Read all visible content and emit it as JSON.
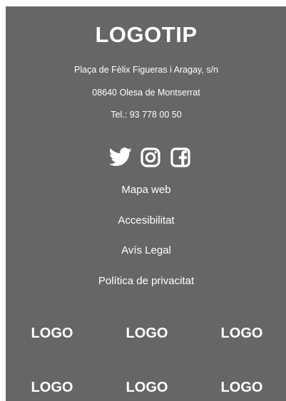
{
  "footer": {
    "title": "LOGOTIP",
    "address": {
      "street": "Plaça de Fèlix Figueras i Aragay, s/n",
      "city": "08640 Olesa de Montserrat",
      "phone": "Tel.: 93 778 00 50"
    },
    "social": [
      "twitter-icon",
      "instagram-icon",
      "facebook-icon"
    ],
    "links": {
      "sitemap": "Mapa web",
      "accessibility": "Accesibilitat",
      "legal": "Avís Legal",
      "privacy": "Política de privacitat"
    },
    "partner_logos": {
      "r1c1": "LOGO",
      "r1c2": "LOGO",
      "r1c3": "LOGO",
      "r2c1": "LOGO",
      "r2c2": "LOGO",
      "r2c3": "LOGO"
    },
    "colors": {
      "background": "#666666",
      "text": "#ffffff"
    }
  }
}
